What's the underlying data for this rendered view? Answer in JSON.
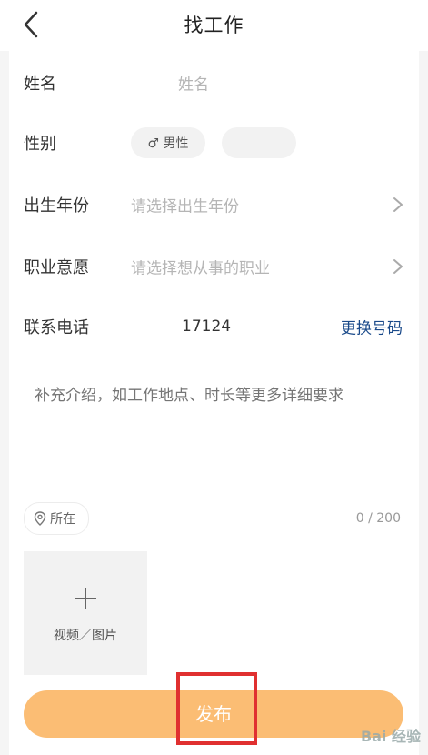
{
  "header": {
    "title": "找工作",
    "back_icon": "chevron-left-icon"
  },
  "form": {
    "name": {
      "label": "姓名",
      "value": "姓名"
    },
    "gender": {
      "label": "性别",
      "options": [
        "♂ 男性",
        ""
      ]
    },
    "birth": {
      "label": "出生年份",
      "placeholder": "请选择出生年份"
    },
    "job": {
      "label": "职业意愿",
      "placeholder": "请选择想从事的职业"
    },
    "phone": {
      "label": "联系电话",
      "value": "17124",
      "change_label": "更换号码"
    },
    "description": {
      "placeholder": "补充介绍，如工作地点、时长等更多详细要求"
    },
    "location": {
      "label": "所在"
    },
    "counter": "0 / 200",
    "upload": {
      "label": "视频／图片"
    },
    "publish_label": "发布"
  },
  "colors": {
    "accent": "#fbbd74",
    "link": "#1a4a8a",
    "highlight": "#e03030"
  },
  "watermark": "Bai 经验"
}
